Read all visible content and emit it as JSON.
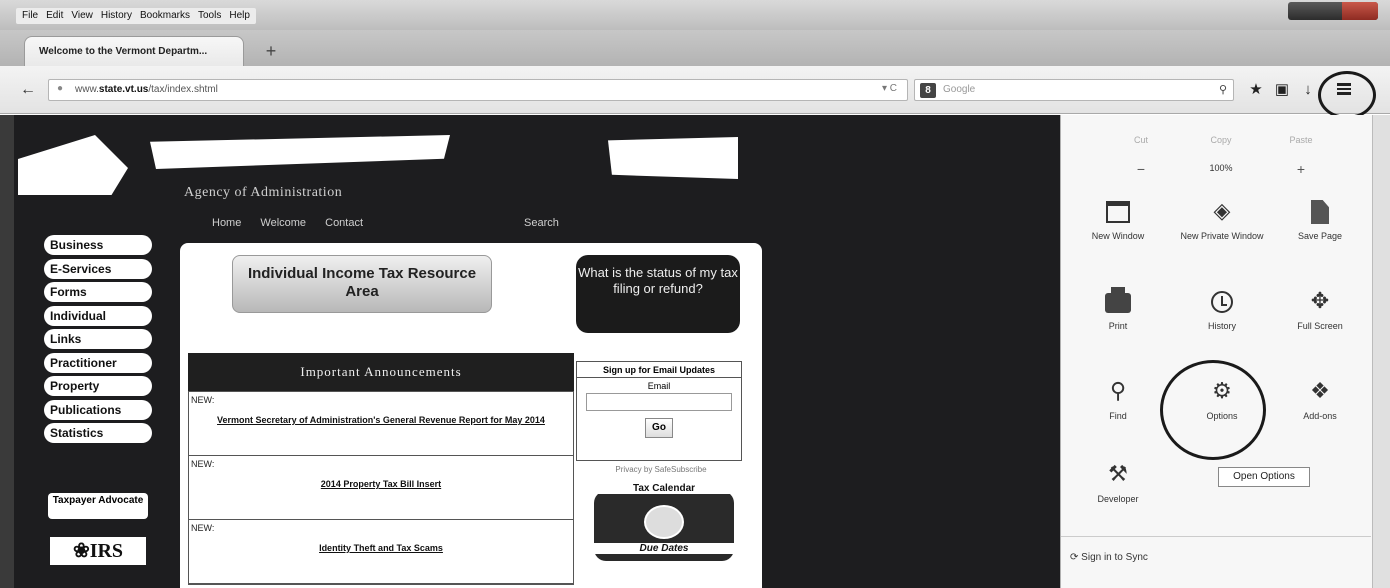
{
  "menubar": {
    "items": [
      "File",
      "Edit",
      "View",
      "History",
      "Bookmarks",
      "Tools",
      "Help"
    ]
  },
  "tab": {
    "title": "Welcome to the Vermont Departm..."
  },
  "toolbar": {
    "new_tab_label": "+",
    "url_prefix": "www.",
    "url_domain": "state.vt.us",
    "url_path": "/tax/index.shtml",
    "search_placeholder": "Google"
  },
  "site": {
    "agency": "Agency of Administration",
    "top_nav": [
      "Home",
      "Welcome",
      "Contact"
    ],
    "search_label": "Search",
    "side_nav": [
      "Business",
      "E-Services",
      "Forms",
      "Individual",
      "Links",
      "Practitioner",
      "Property",
      "Publications",
      "Statistics"
    ],
    "advocate_label": "Taxpayer Advocate",
    "irs_label": "IRS",
    "resource_title": "Individual Income Tax Resource Area",
    "status_question": "What is the status of my tax filing or refund?",
    "announcements_title": "Important Announcements",
    "announcements": [
      {
        "tag": "NEW:",
        "link": "Vermont Secretary of Administration's General Revenue Report for May 2014"
      },
      {
        "tag": "NEW:",
        "link": "2014 Property Tax Bill Insert"
      },
      {
        "tag": "NEW:",
        "link": "Identity Theft and Tax Scams"
      }
    ],
    "signup_title": "Sign up for Email Updates",
    "email_label": "Email",
    "go_label": "Go",
    "powered_by": "Privacy by SafeSubscribe",
    "tax_calendar": "Tax Calendar",
    "due_dates": "Due Dates"
  },
  "panel": {
    "cut": "Cut",
    "copy": "Copy",
    "paste": "Paste",
    "zoom_out": "−",
    "zoom": "100%",
    "zoom_in": "+",
    "new_window": "New Window",
    "private_window": "New Private Window",
    "save_page": "Save Page",
    "print": "Print",
    "history": "History",
    "full_screen": "Full Screen",
    "find": "Find",
    "options": "Options",
    "addons": "Add-ons",
    "developer": "Developer",
    "tooltip": "Open Options",
    "sync": "Sign in to Sync"
  }
}
